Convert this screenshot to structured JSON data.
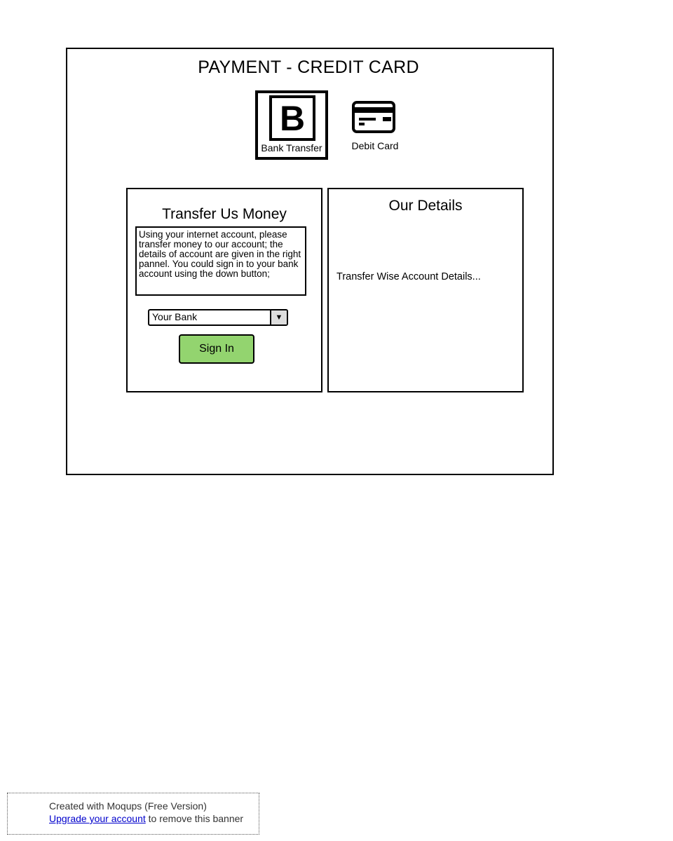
{
  "page": {
    "title": "PAYMENT - CREDIT CARD"
  },
  "payment_methods": [
    {
      "label": "Bank Transfer",
      "icon": "bank-b-icon",
      "selected": true
    },
    {
      "label": "Debit Card",
      "icon": "credit-card-icon",
      "selected": false
    }
  ],
  "transfer_panel": {
    "title": "Transfer Us Money",
    "instructions": "Using your internet account, please transfer money to our account; the details of account are given in the right pannel. You could sign in to your bank account using the down button;",
    "bank_select": {
      "value": "Your Bank",
      "arrow_icon": "triangle-down-icon"
    },
    "sign_in_label": "Sign In",
    "sign_in_color": "#93d46f"
  },
  "details_panel": {
    "title": "Our Details",
    "text": "Transfer Wise Account Details..."
  },
  "banner": {
    "line1": "Created with Moqups (Free Version)",
    "link_text": "Upgrade your account",
    "line2_rest": " to remove this banner"
  }
}
